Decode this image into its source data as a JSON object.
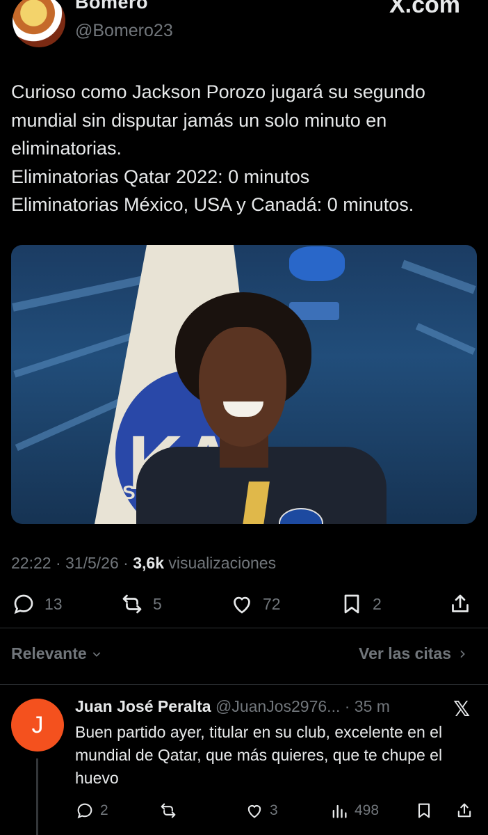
{
  "header": {
    "display_name_cut": "Bomero",
    "handle": "@Bomero23",
    "watermark": "X.com"
  },
  "tweet": {
    "lines": [
      "Curioso como Jackson Porozo jugará su segundo mundial sin disputar jamás un solo minuto en eliminatorias.",
      "Eliminatorias Qatar 2022: 0 minutos",
      "Eliminatorias México, USA y Canadá: 0 minutos."
    ],
    "time": "22:22",
    "date": "31/5/26",
    "views_count": "3,6k",
    "views_label": "visualizaciones",
    "photo_text": "KA",
    "actions": {
      "replies": "13",
      "retweets": "5",
      "likes": "72",
      "bookmarks": "2"
    }
  },
  "filter": {
    "sort_label": "Relevante",
    "quotes_link": "Ver las citas"
  },
  "reply": {
    "avatar_letter": "J",
    "name": "Juan José Peralta",
    "handle": "@JuanJos2976...",
    "time": "· 35 m",
    "text": "Buen partido ayer, titular en su club, excelente en el mundial de Qatar, que más quieres, que te chupe el huevo",
    "actions": {
      "replies": "2",
      "retweets": "",
      "likes": "3",
      "views": "498"
    }
  },
  "colors": {
    "background": "#000000",
    "text": "#e7e9ea",
    "muted": "#71767b",
    "reply_avatar": "#f4511e"
  }
}
